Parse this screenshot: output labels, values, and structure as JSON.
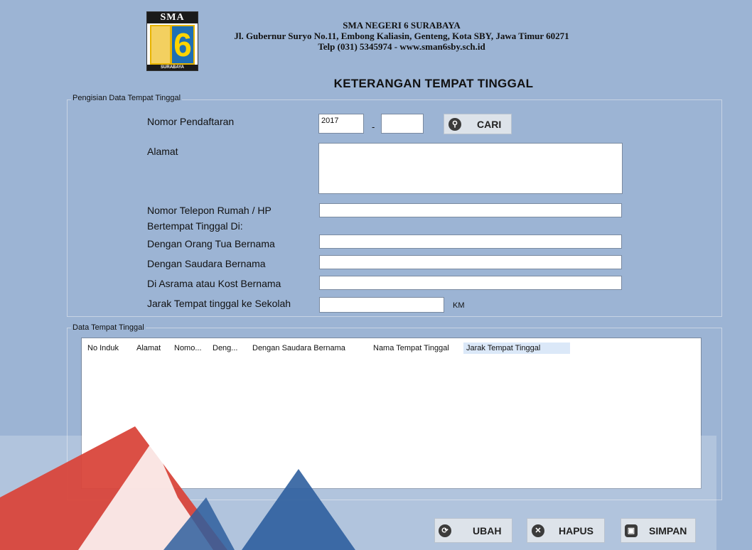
{
  "header": {
    "logo_text_top": "SMA",
    "logo_number": "6",
    "logo_text_bottom": "SURABAYA",
    "school_name": "SMA NEGERI 6 SURABAYA",
    "address": "Jl. Gubernur Suryo No.11, Embong Kaliasin, Genteng, Kota SBY, Jawa Timur 60271",
    "contact": "Telp (031) 5345974 - www.sman6sby.sch.id",
    "form_title": "KETERANGAN TEMPAT TINGGAL"
  },
  "form": {
    "group_label": "Pengisian Data Tempat Tinggal",
    "labels": {
      "nomor_pendaftaran": "Nomor Pendaftaran",
      "alamat": "Alamat",
      "telepon": "Nomor Telepon Rumah / HP",
      "bertempat": "Bertempat Tinggal Di:",
      "orang_tua": "Dengan Orang Tua Bernama",
      "saudara": "Dengan Saudara Bernama",
      "asrama": "Di Asrama atau Kost Bernama",
      "jarak": "Jarak Tempat tinggal ke Sekolah"
    },
    "values": {
      "nomor_year": "2017",
      "nomor_separator": "-",
      "nomor_suffix": "",
      "alamat": "",
      "telepon": "",
      "orang_tua": "",
      "saudara": "",
      "asrama": "",
      "jarak": ""
    },
    "jarak_unit": "KM",
    "cari_label": "CARI"
  },
  "table": {
    "group_label": "Data Tempat Tinggal",
    "columns": [
      "No Induk",
      "Alamat",
      "Nomo...",
      "Deng...",
      "Dengan Saudara Bernama",
      "Nama Tempat Tinggal",
      "Jarak Tempat Tinggal"
    ],
    "rows": []
  },
  "actions": {
    "ubah": "UBAH",
    "hapus": "HAPUS",
    "simpan": "SIMPAN"
  },
  "colors": {
    "background": "#9cb4d4",
    "button": "#dde3ea",
    "icon": "#3b3b3b",
    "watermark_red": "#d9463b",
    "watermark_blue": "#2f5f9e"
  },
  "icons": {
    "search": "search-icon",
    "ubah": "refresh-icon",
    "hapus": "close-icon",
    "simpan": "save-icon"
  }
}
